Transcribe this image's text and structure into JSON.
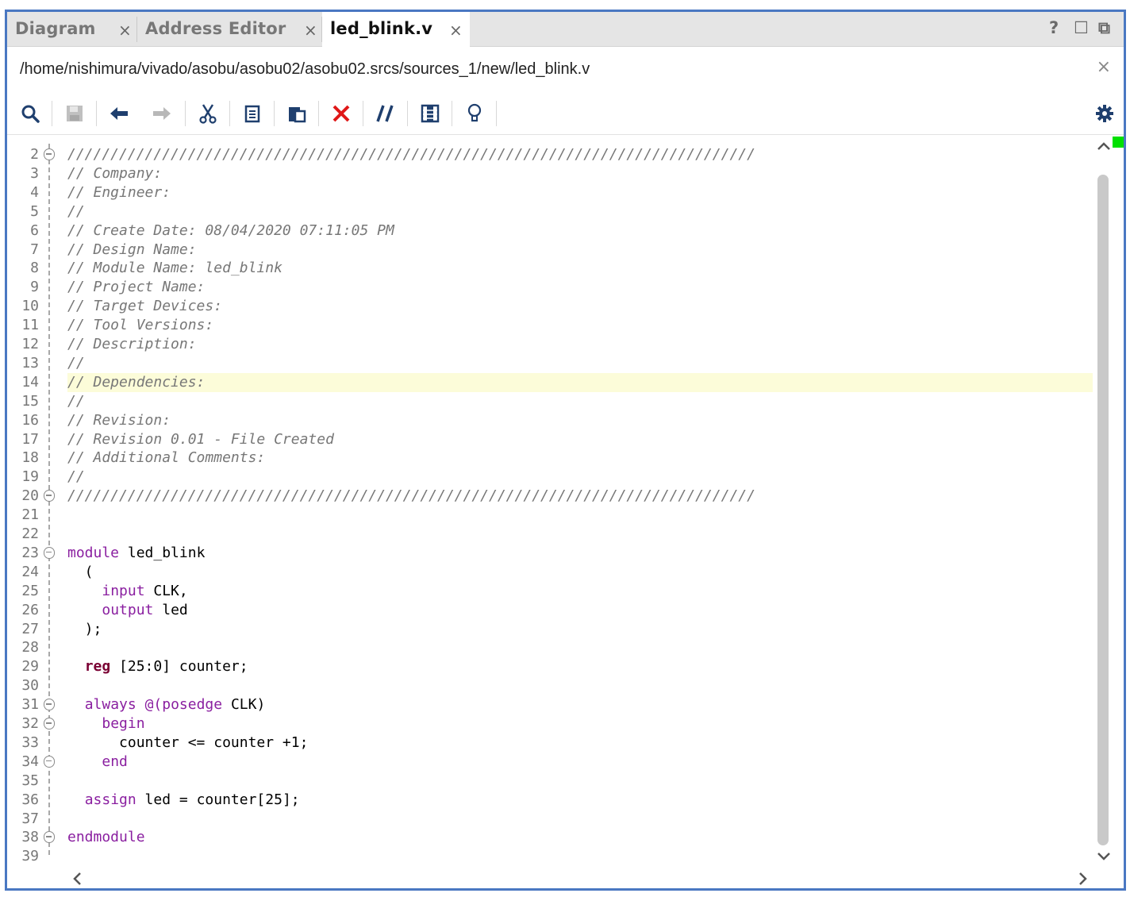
{
  "tabs": [
    {
      "label": "Diagram",
      "close": "×",
      "active": false
    },
    {
      "label": "Address Editor",
      "close": "×",
      "active": false
    },
    {
      "label": "led_blink.v",
      "close": "×",
      "active": true
    }
  ],
  "window_controls": {
    "help": "?",
    "restore": "☐",
    "float": "⧉"
  },
  "path": {
    "text": "/home/nishimura/vivado/asobu/asobu02/asobu02.srcs/sources_1/new/led_blink.v",
    "close": "×"
  },
  "toolbar": {
    "icons": [
      "search-icon",
      "save-icon",
      "undo-icon",
      "redo-icon",
      "cut-icon",
      "copy-icon",
      "paste-icon",
      "delete-icon",
      "comment-icon",
      "block-icon",
      "lightbulb-icon",
      "gear-icon"
    ]
  },
  "editor": {
    "highlighted_line": 14,
    "lines": [
      {
        "n": "2",
        "segs": [
          {
            "t": "////////////////////////////////////////////////////////////////////////////////",
            "c": "cm"
          }
        ]
      },
      {
        "n": "3",
        "segs": [
          {
            "t": "// Company:",
            "c": "cm"
          }
        ]
      },
      {
        "n": "4",
        "segs": [
          {
            "t": "// Engineer:",
            "c": "cm"
          }
        ]
      },
      {
        "n": "5",
        "segs": [
          {
            "t": "//",
            "c": "cm"
          }
        ]
      },
      {
        "n": "6",
        "segs": [
          {
            "t": "// Create Date: 08/04/2020 07:11:05 PM",
            "c": "cm"
          }
        ]
      },
      {
        "n": "7",
        "segs": [
          {
            "t": "// Design Name:",
            "c": "cm"
          }
        ]
      },
      {
        "n": "8",
        "segs": [
          {
            "t": "// Module Name: led_blink",
            "c": "cm"
          }
        ]
      },
      {
        "n": "9",
        "segs": [
          {
            "t": "// Project Name:",
            "c": "cm"
          }
        ]
      },
      {
        "n": "10",
        "segs": [
          {
            "t": "// Target Devices:",
            "c": "cm"
          }
        ]
      },
      {
        "n": "11",
        "segs": [
          {
            "t": "// Tool Versions:",
            "c": "cm"
          }
        ]
      },
      {
        "n": "12",
        "segs": [
          {
            "t": "// Description:",
            "c": "cm"
          }
        ]
      },
      {
        "n": "13",
        "segs": [
          {
            "t": "//",
            "c": "cm"
          }
        ]
      },
      {
        "n": "14",
        "segs": [
          {
            "t": "// Dependencies:",
            "c": "cm"
          }
        ]
      },
      {
        "n": "15",
        "segs": [
          {
            "t": "//",
            "c": "cm"
          }
        ]
      },
      {
        "n": "16",
        "segs": [
          {
            "t": "// Revision:",
            "c": "cm"
          }
        ]
      },
      {
        "n": "17",
        "segs": [
          {
            "t": "// Revision 0.01 - File Created",
            "c": "cm"
          }
        ]
      },
      {
        "n": "18",
        "segs": [
          {
            "t": "// Additional Comments:",
            "c": "cm"
          }
        ]
      },
      {
        "n": "19",
        "segs": [
          {
            "t": "//",
            "c": "cm"
          }
        ]
      },
      {
        "n": "20",
        "segs": [
          {
            "t": "////////////////////////////////////////////////////////////////////////////////",
            "c": "cm"
          }
        ]
      },
      {
        "n": "21",
        "segs": []
      },
      {
        "n": "22",
        "segs": []
      },
      {
        "n": "23",
        "segs": [
          {
            "t": "module",
            "c": "kw"
          },
          {
            "t": " led_blink",
            "c": ""
          }
        ]
      },
      {
        "n": "24",
        "segs": [
          {
            "t": "  (",
            "c": ""
          }
        ]
      },
      {
        "n": "25",
        "segs": [
          {
            "t": "    ",
            "c": ""
          },
          {
            "t": "input",
            "c": "kw"
          },
          {
            "t": " CLK,",
            "c": ""
          }
        ]
      },
      {
        "n": "26",
        "segs": [
          {
            "t": "    ",
            "c": ""
          },
          {
            "t": "output",
            "c": "kw"
          },
          {
            "t": " led",
            "c": ""
          }
        ]
      },
      {
        "n": "27",
        "segs": [
          {
            "t": "  );",
            "c": ""
          }
        ]
      },
      {
        "n": "28",
        "segs": []
      },
      {
        "n": "29",
        "segs": [
          {
            "t": "  ",
            "c": ""
          },
          {
            "t": "reg",
            "c": "kwb"
          },
          {
            "t": " [25:0] counter;",
            "c": ""
          }
        ]
      },
      {
        "n": "30",
        "segs": []
      },
      {
        "n": "31",
        "segs": [
          {
            "t": "  ",
            "c": ""
          },
          {
            "t": "always",
            "c": "kw"
          },
          {
            "t": " ",
            "c": ""
          },
          {
            "t": "@(posedge",
            "c": "kw"
          },
          {
            "t": " CLK)",
            "c": ""
          }
        ]
      },
      {
        "n": "32",
        "segs": [
          {
            "t": "    ",
            "c": ""
          },
          {
            "t": "begin",
            "c": "kw"
          }
        ]
      },
      {
        "n": "33",
        "segs": [
          {
            "t": "      counter <= counter +1;",
            "c": ""
          }
        ]
      },
      {
        "n": "34",
        "segs": [
          {
            "t": "    ",
            "c": ""
          },
          {
            "t": "end",
            "c": "kw"
          }
        ]
      },
      {
        "n": "35",
        "segs": []
      },
      {
        "n": "36",
        "segs": [
          {
            "t": "  ",
            "c": ""
          },
          {
            "t": "assign",
            "c": "kw"
          },
          {
            "t": " led = counter[25];",
            "c": ""
          }
        ]
      },
      {
        "n": "37",
        "segs": []
      },
      {
        "n": "38",
        "segs": [
          {
            "t": "endmodule",
            "c": "kw"
          }
        ]
      },
      {
        "n": "39",
        "segs": []
      }
    ],
    "fold_markers": [
      "2",
      "20",
      "23",
      "31",
      "32",
      "34",
      "38"
    ]
  }
}
